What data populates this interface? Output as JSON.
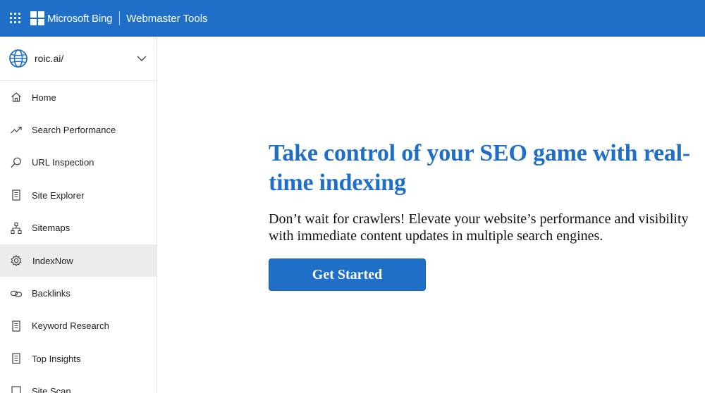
{
  "header": {
    "brand": "Microsoft Bing",
    "product": "Webmaster Tools",
    "icons": [
      "app-launcher-icon",
      "microsoft-logo-icon"
    ],
    "color": "#1f6fc8"
  },
  "sidebar": {
    "site": "roic.ai/",
    "items": [
      {
        "label": "Home",
        "icon": "home-icon"
      },
      {
        "label": "Search Performance",
        "icon": "trend-icon"
      },
      {
        "label": "URL Inspection",
        "icon": "search-icon"
      },
      {
        "label": "Site Explorer",
        "icon": "document-icon"
      },
      {
        "label": "Sitemaps",
        "icon": "sitemap-icon"
      },
      {
        "label": "IndexNow",
        "icon": "gear-icon",
        "active": true
      },
      {
        "label": "Backlinks",
        "icon": "link-icon"
      },
      {
        "label": "Keyword Research",
        "icon": "document-icon"
      },
      {
        "label": "Top Insights",
        "icon": "document-icon"
      },
      {
        "label": "Site Scan",
        "icon": "scan-icon"
      }
    ]
  },
  "main": {
    "headline": "Take control of your SEO game with real-time indexing",
    "subtext_line1": "Don’t wait for crawlers! Elevate your website’s performance and visibility",
    "subtext_line2": "with immediate content updates in multiple search engines.",
    "cta_label": "Get Started"
  }
}
